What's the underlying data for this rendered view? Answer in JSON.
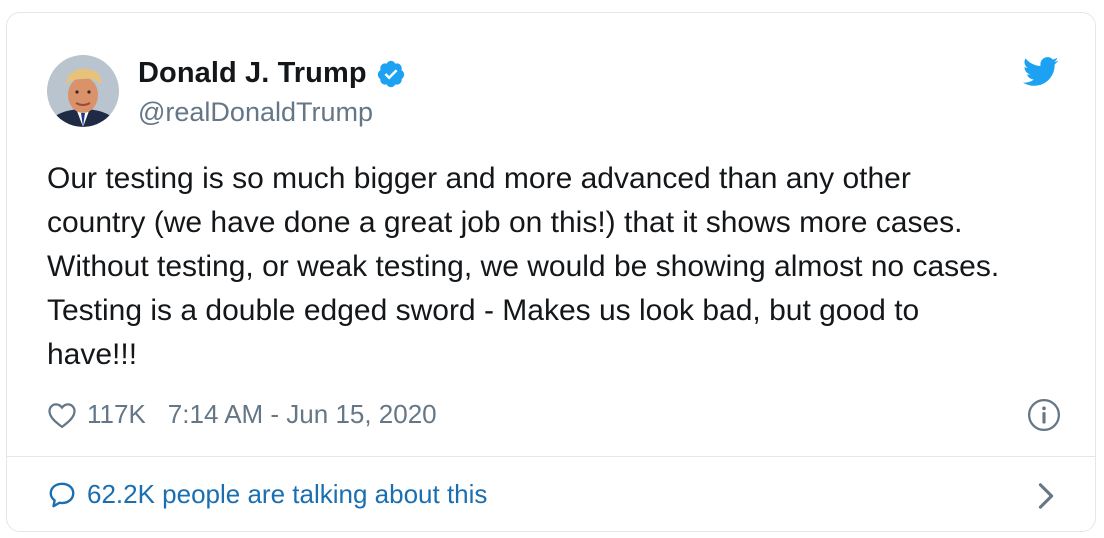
{
  "author": {
    "name": "Donald J. Trump",
    "handle": "@realDonaldTrump",
    "verified": true,
    "avatar_icon": "avatar-photo"
  },
  "tweet": {
    "text": "Our testing is so much bigger and more advanced than any other\ncountry (we have done a great job on this!) that it shows more cases.\nWithout testing, or weak testing, we would be showing almost no cases.\nTesting is a double edged sword - Makes us look bad, but good to\nhave!!!",
    "likes": "117K",
    "timestamp": "7:14 AM - Jun 15, 2020"
  },
  "footer": {
    "talking_label": "62.2K people are talking about this"
  },
  "icons": {
    "logo": "twitter-bird-icon",
    "verified": "verified-badge-icon",
    "like": "heart-icon",
    "info": "info-icon",
    "reply": "speech-bubble-icon",
    "more": "chevron-right-icon"
  },
  "colors": {
    "twitter_blue": "#1da1f2",
    "link_blue": "#1b6fb0",
    "text": "#14171a",
    "muted": "#657786",
    "border": "#e1e8ed"
  }
}
